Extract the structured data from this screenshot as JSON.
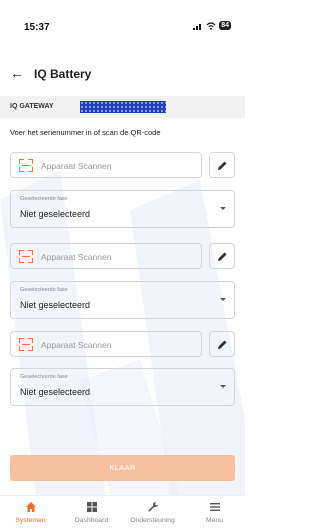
{
  "status_bar": {
    "time": "15:37",
    "battery": "84"
  },
  "header": {
    "title": "IQ Battery"
  },
  "gateway": {
    "label": "IQ GATEWAY"
  },
  "instruction": "Voer het serienummer in of scan de QR-code",
  "devices": [
    {
      "scan_placeholder": "Apparaat Scannen",
      "phase_label": "Geselecteerde fase",
      "phase_value": "Niet geselecteerd"
    },
    {
      "scan_placeholder": "Apparaat Scannen",
      "phase_label": "Geselecteerde fase",
      "phase_value": "Niet geselecteerd"
    },
    {
      "scan_placeholder": "Apparaat Scannen",
      "phase_label": "Geselecteerde fase",
      "phase_value": "Niet geselecteerd"
    }
  ],
  "submit_label": "KLAAR",
  "bottom_nav": [
    {
      "label": "Systemen",
      "icon": "home-icon",
      "active": true
    },
    {
      "label": "Dashboard",
      "icon": "dashboard-icon",
      "active": false
    },
    {
      "label": "Ondersteuning",
      "icon": "wrench-icon",
      "active": false
    },
    {
      "label": "Menu",
      "icon": "menu-icon",
      "active": false
    }
  ],
  "colors": {
    "accent": "#f06a2a",
    "submit_disabled": "#f7c1a0",
    "gateway_serial_mask": "#1e3fb8"
  }
}
